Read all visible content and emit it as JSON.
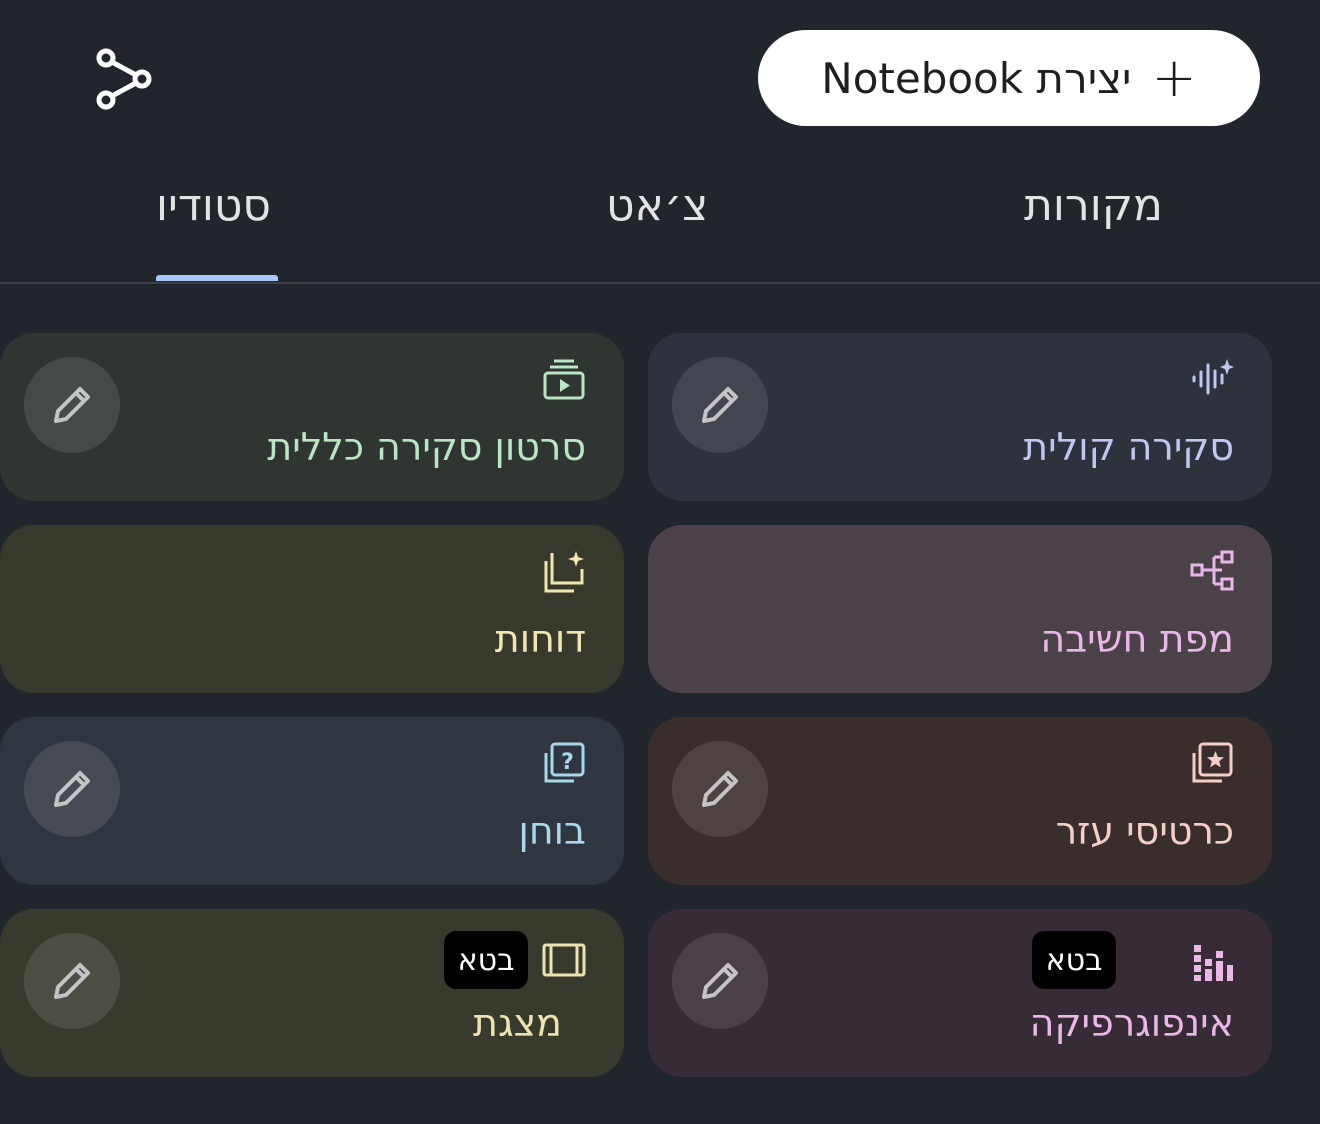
{
  "header": {
    "create_button_label": "יצירת Notebook",
    "share_icon": "share-icon",
    "plus_icon": "plus-icon"
  },
  "tabs": [
    {
      "label": "מקורות",
      "selected": false
    },
    {
      "label": "צ׳אט",
      "selected": false
    },
    {
      "label": "סטודיו",
      "selected": true
    }
  ],
  "accent_color": "#a8c7fa",
  "studio": {
    "beta_label": "בטא",
    "cards": [
      {
        "title": "סקירה קולית",
        "icon": "audio-overview-icon",
        "color": "#c2c7f0",
        "editable": true
      },
      {
        "title": "סרטון סקירה כללית",
        "icon": "video-overview-icon",
        "color": "#b9e6c4",
        "editable": true
      },
      {
        "title": "מפת חשיבה",
        "icon": "mind-map-icon",
        "color": "#e8b7e8",
        "editable": false
      },
      {
        "title": "דוחות",
        "icon": "reports-icon",
        "color": "#f1e6b3",
        "editable": false
      },
      {
        "title": "כרטיסי עזר",
        "icon": "flashcards-icon",
        "color": "#f3cfc5",
        "editable": true
      },
      {
        "title": "בוחן",
        "icon": "quiz-icon",
        "color": "#a9d8e8",
        "editable": true
      },
      {
        "title": "אינפוגרפיקה",
        "icon": "infographic-icon",
        "color": "#eab8e6",
        "editable": true,
        "beta": true
      },
      {
        "title": "מצגת",
        "icon": "slides-icon",
        "color": "#ece3b0",
        "editable": true,
        "beta": true
      }
    ]
  }
}
